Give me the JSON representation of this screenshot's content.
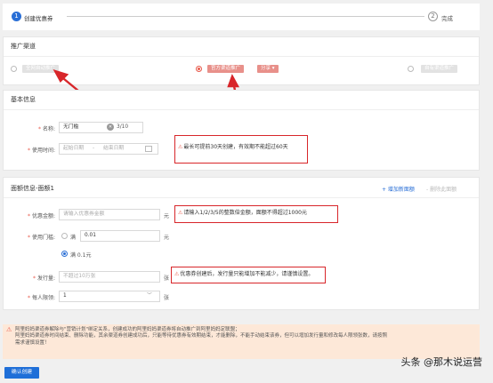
{
  "steps": [
    {
      "number": "1",
      "label": "创建优惠券"
    },
    {
      "number": "2",
      "label": "完成"
    }
  ],
  "channel": {
    "title": "推广渠道",
    "options": [
      {
        "label": "全网自动推广",
        "selected": false
      },
      {
        "label": "官方渠道推广",
        "selected": true,
        "extra": "分享"
      },
      {
        "label": "自有渠道推广",
        "selected": false
      }
    ]
  },
  "basic": {
    "title": "基本信息",
    "name_label": "名称:",
    "name_value": "无门槛",
    "name_count": "3/10",
    "time_label": "使用时间:",
    "start_placeholder": "起始日期",
    "range_sep": "-",
    "end_placeholder": "结束日期",
    "tip": "最长可提前30天创建，有效期不能超过60天"
  },
  "denomination": {
    "title": "面额信息-面额1",
    "add_link": "+ 增加新面额",
    "delete_link": "- 删除此面额",
    "amount_label": "优惠金额:",
    "amount_placeholder": "请输入优惠券金额",
    "amount_unit": "元",
    "amount_tip": "请输入1/2/3/5的整数倍金额，面额不得超过1000元",
    "threshold_label": "使用门槛:",
    "threshold_option1_prefix": "满",
    "threshold_value": "0.01",
    "threshold_unit": "元",
    "threshold_option2": "满 0.1元",
    "issue_label": "发行量:",
    "issue_placeholder": "不超过10万张",
    "issue_unit": "张",
    "issue_tip": "优惠券创建后，发行量只能增加不能减少，请谨慎设置。",
    "limit_label": "每人限领:",
    "limit_value": "1",
    "limit_unit": "张"
  },
  "notice": {
    "line1": "阿里妈妈渠道券解除与\"营销计划\"绑定关系，创建成功的阿里妈妈渠道券将自动推广到阿里妈妈定联盟；",
    "line2": "阿里妈妈渠道券时间结束、删除功能，其余渠道券创建成功后，只能等待优惠券有效期结束，才能删除，不能手动结束该券，但可以增加发行量和修改每人限领张数，请按照",
    "line3": "需求谨慎设置！"
  },
  "confirm_button": "确认创建",
  "watermark": "头条 @那木说运营",
  "colors": {
    "accent_blue": "#1f6fd8",
    "tag_red": "#e8908a",
    "warn_red": "#d8262a",
    "notice_bg": "#fde8d8"
  }
}
